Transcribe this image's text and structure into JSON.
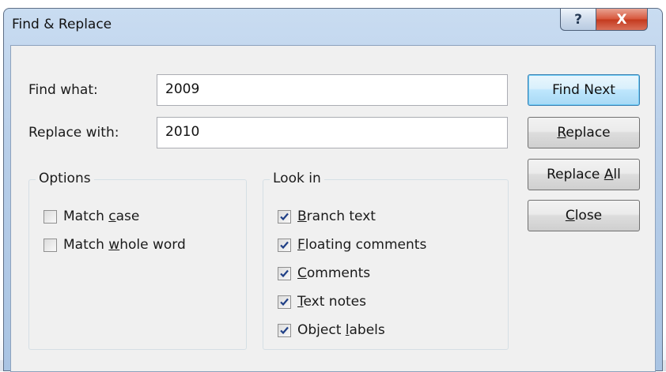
{
  "window": {
    "title": "Find & Replace",
    "help_glyph": "?",
    "close_glyph": "X"
  },
  "find": {
    "label": "Find what:",
    "value": "2009"
  },
  "replace": {
    "label": "Replace with:",
    "value": "2010"
  },
  "buttons": {
    "find_next": "Find Next",
    "replace": {
      "pre": "",
      "mnemonic": "R",
      "post": "eplace"
    },
    "replace_all": {
      "pre": "Replace ",
      "mnemonic": "A",
      "post": "ll"
    },
    "close": {
      "pre": "",
      "mnemonic": "C",
      "post": "lose"
    }
  },
  "options": {
    "title": "Options",
    "items": [
      {
        "pre": "Match ",
        "mnemonic": "c",
        "post": "ase",
        "checked": false
      },
      {
        "pre": "Match ",
        "mnemonic": "w",
        "post": "hole word",
        "checked": false
      }
    ]
  },
  "look_in": {
    "title": "Look in",
    "items": [
      {
        "pre": "",
        "mnemonic": "B",
        "post": "ranch text",
        "checked": true
      },
      {
        "pre": "",
        "mnemonic": "F",
        "post": "loating comments",
        "checked": true
      },
      {
        "pre": "",
        "mnemonic": "C",
        "post": "omments",
        "checked": true
      },
      {
        "pre": "",
        "mnemonic": "T",
        "post": "ext notes",
        "checked": true
      },
      {
        "pre": "Object ",
        "mnemonic": "l",
        "post": "abels",
        "checked": true
      }
    ]
  },
  "colors": {
    "check_mark": "#1f3f86",
    "default_button_border": "#3c7fb1",
    "close_button": "#c43a1e"
  }
}
